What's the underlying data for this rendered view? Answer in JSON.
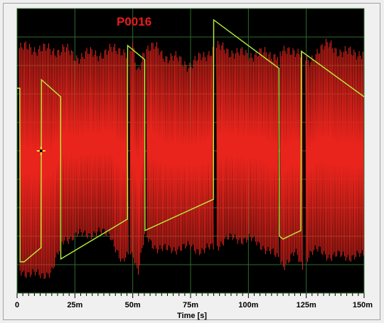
{
  "chart_data": {
    "type": "line",
    "title": "P0016",
    "xlabel": "Time [s]",
    "xlim": [
      0,
      150
    ],
    "x_ticks": [
      0,
      25,
      50,
      75,
      100,
      125,
      150
    ],
    "x_tick_labels": [
      "0",
      "25m",
      "50m",
      "75m",
      "100m",
      "125m",
      "150m"
    ],
    "grid": true,
    "background": "#000000",
    "grid_color": "#2e6b2e",
    "series": [
      {
        "color": "#e8241c",
        "style": "dense oscillation (envelope, y = % of plot height, 100 = top)",
        "envelope": [
          {
            "x": 0.5,
            "max": 86,
            "min": 8
          },
          {
            "x": 5,
            "max": 86,
            "min": 7
          },
          {
            "x": 10,
            "max": 86,
            "min": 6
          },
          {
            "x": 15,
            "max": 85,
            "min": 8
          },
          {
            "x": 20,
            "max": 86,
            "min": 19
          },
          {
            "x": 25,
            "max": 83,
            "min": 20
          },
          {
            "x": 30,
            "max": 84,
            "min": 21
          },
          {
            "x": 35,
            "max": 84,
            "min": 21
          },
          {
            "x": 40,
            "max": 85,
            "min": 21
          },
          {
            "x": 45,
            "max": 86,
            "min": 10
          },
          {
            "x": 48,
            "max": 84,
            "min": 14
          },
          {
            "x": 50,
            "max": 86,
            "min": 14
          },
          {
            "x": 52,
            "max": 77,
            "min": 7
          },
          {
            "x": 55,
            "max": 86,
            "min": 20
          },
          {
            "x": 60,
            "max": 86,
            "min": 16
          },
          {
            "x": 65,
            "max": 83,
            "min": 15
          },
          {
            "x": 70,
            "max": 82,
            "min": 16
          },
          {
            "x": 75,
            "max": 80,
            "min": 16
          },
          {
            "x": 80,
            "max": 83,
            "min": 15
          },
          {
            "x": 85,
            "max": 86,
            "min": 16
          },
          {
            "x": 90,
            "max": 86,
            "min": 19
          },
          {
            "x": 95,
            "max": 84,
            "min": 19
          },
          {
            "x": 100,
            "max": 84,
            "min": 19
          },
          {
            "x": 105,
            "max": 84,
            "min": 17
          },
          {
            "x": 110,
            "max": 84,
            "min": 14
          },
          {
            "x": 115,
            "max": 84,
            "min": 10
          },
          {
            "x": 120,
            "max": 86,
            "min": 14
          },
          {
            "x": 123,
            "max": 84,
            "min": 9
          },
          {
            "x": 126,
            "max": 80,
            "min": 14
          },
          {
            "x": 130,
            "max": 86,
            "min": 15
          },
          {
            "x": 135,
            "max": 87,
            "min": 13
          },
          {
            "x": 140,
            "max": 85,
            "min": 13
          },
          {
            "x": 145,
            "max": 84,
            "min": 13
          },
          {
            "x": 149.5,
            "max": 85,
            "min": 13
          }
        ],
        "gaps": [
          [
            47.8,
            48.6
          ],
          [
            55.1,
            55.9
          ],
          [
            84.9,
            85.8
          ],
          [
            112.8,
            113.6
          ],
          [
            123.6,
            124.4
          ]
        ]
      },
      {
        "color": "#b6f23a",
        "style": "sawtooth (y = % of plot height, 100 = top)",
        "points": [
          {
            "x": 0,
            "y": 72
          },
          {
            "x": 1.2,
            "y": 72
          },
          {
            "x": 1.3,
            "y": 11
          },
          {
            "x": 3,
            "y": 11
          },
          {
            "x": 10.4,
            "y": 16
          },
          {
            "x": 10.5,
            "y": 75
          },
          {
            "x": 18.8,
            "y": 69
          },
          {
            "x": 18.9,
            "y": 12
          },
          {
            "x": 47.7,
            "y": 26
          },
          {
            "x": 47.8,
            "y": 87
          },
          {
            "x": 55.2,
            "y": 82
          },
          {
            "x": 55.3,
            "y": 22
          },
          {
            "x": 84.9,
            "y": 33
          },
          {
            "x": 85.0,
            "y": 96
          },
          {
            "x": 113.2,
            "y": 79
          },
          {
            "x": 113.4,
            "y": 20
          },
          {
            "x": 115,
            "y": 19
          },
          {
            "x": 120,
            "y": 21
          },
          {
            "x": 122.7,
            "y": 22
          },
          {
            "x": 122.9,
            "y": 85
          },
          {
            "x": 150,
            "y": 69
          }
        ]
      }
    ],
    "cursor": {
      "x": 10.4,
      "y": 50
    }
  }
}
